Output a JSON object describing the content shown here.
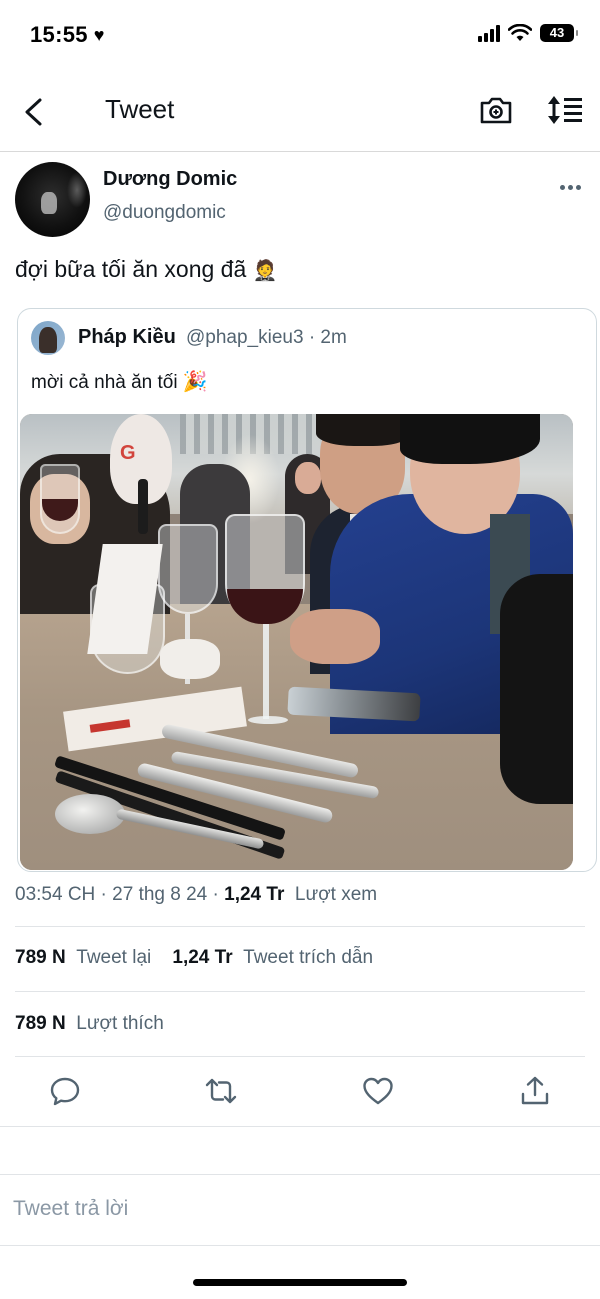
{
  "status_bar": {
    "time": "15:55",
    "battery": "43"
  },
  "header": {
    "title": "Tweet"
  },
  "tweet": {
    "author_name": "Dương Domic",
    "author_handle": "@duongdomic",
    "text": "đợi bữa tối ăn xong đã",
    "text_emoji": "🤵",
    "timestamp": "03:54 CH · 27 thg 8 24 · ",
    "views_count": "1,24 Tr",
    "views_label": "Lượt xem"
  },
  "quoted_tweet": {
    "author_name": "Pháp Kiều",
    "author_handle": "@phap_kieu3 · 2m",
    "text": "mời cả nhà ăn tối",
    "text_emoji": "🎉",
    "photo_sign_text": "G"
  },
  "stats": {
    "retweets_count": "789 N",
    "retweets_label": "Tweet lại",
    "quotes_count": "1,24 Tr",
    "quotes_label": "Tweet trích dẫn",
    "likes_count": "789 N",
    "likes_label": "Lượt thích"
  },
  "actions": {
    "reply_icon": "reply-icon",
    "retweet_icon": "retweet-icon",
    "like_icon": "heart-icon",
    "share_icon": "share-icon"
  },
  "reply_box": {
    "placeholder": "Tweet trả lời"
  },
  "colors": {
    "text_primary": "#0f1419",
    "text_secondary": "#536471",
    "border": "#cfd9de"
  }
}
